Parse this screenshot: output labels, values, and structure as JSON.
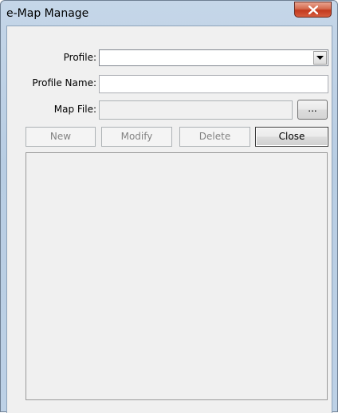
{
  "window": {
    "title": "e-Map Manage"
  },
  "form": {
    "profile_label": "Profile:",
    "profile_value": "",
    "profile_name_label": "Profile Name:",
    "profile_name_value": "",
    "map_file_label": "Map File:",
    "map_file_value": "",
    "browse_label": "..."
  },
  "buttons": {
    "new_label": "New",
    "modify_label": "Modify",
    "delete_label": "Delete",
    "close_label": "Close"
  },
  "icons": {
    "close": "close-icon",
    "dropdown": "chevron-down-icon"
  }
}
